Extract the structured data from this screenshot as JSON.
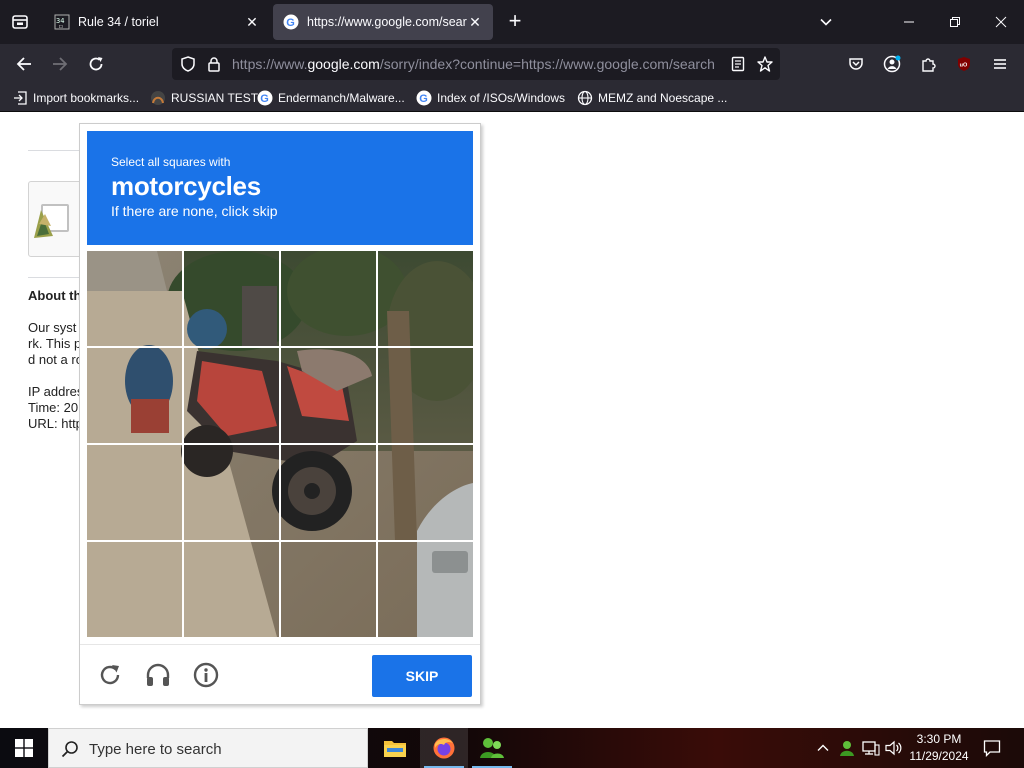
{
  "browser": {
    "tabs": [
      {
        "title": "Rule 34 / toriel",
        "favicon": "rule34-favicon",
        "active": false
      },
      {
        "title": "https://www.google.com/searc",
        "favicon": "google-favicon",
        "active": true
      }
    ],
    "new_tab_label": "+",
    "url": {
      "prefix": "https://www.",
      "domain": "google.com",
      "rest": "/sorry/index?continue=https://www.google.com/search"
    },
    "bookmarks": [
      {
        "label": "Import bookmarks...",
        "icon": "import-icon"
      },
      {
        "label": "RUSSIAN TEST",
        "icon": "github-icon"
      },
      {
        "label": "Endermanch/Malware...",
        "icon": "google-icon"
      },
      {
        "label": "Index of /ISOs/Windows",
        "icon": "google-icon"
      },
      {
        "label": "MEMZ and Noescape ...",
        "icon": "globe-icon"
      }
    ],
    "colors": {
      "chrome_dark": "#1c1b22",
      "toolbar": "#2b2a33",
      "active_tab": "#42414d"
    }
  },
  "page": {
    "about_title": "About th",
    "about_lines": [
      "Our syst",
      "rk. This p",
      "d not a ro",
      "IP addres",
      "Time: 20",
      "URL: http"
    ]
  },
  "challenge": {
    "line1": "Select all squares with",
    "keyword": "motorcycles",
    "line2": "If there are none, click skip",
    "skip_label": "SKIP",
    "accent": "#1a73e8",
    "footer_icons": [
      "reload-icon",
      "audio-challenge-icon",
      "info-icon"
    ]
  },
  "taskbar": {
    "search_placeholder": "Type here to search",
    "apps": [
      "file-explorer-icon",
      "firefox-icon",
      "people-app-icon"
    ],
    "time": "3:30 PM",
    "date": "11/29/2024"
  }
}
